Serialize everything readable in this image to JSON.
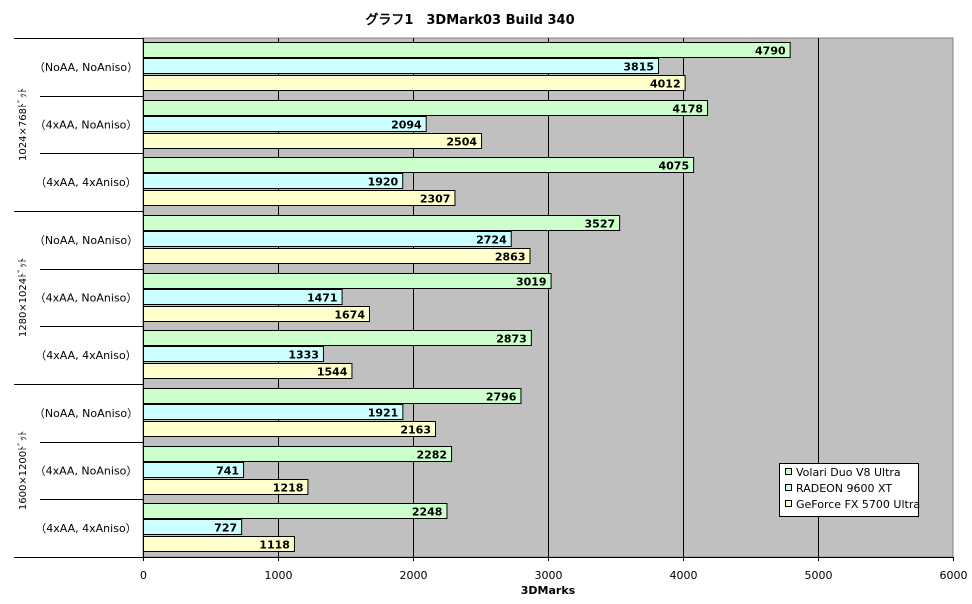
{
  "chart_data": {
    "type": "bar",
    "orientation": "horizontal",
    "title": "グラフ1　3DMark03  Build 340",
    "xlabel": "3DMarks",
    "xlim": [
      0,
      6000
    ],
    "x_ticks": [
      "0",
      "1000",
      "2000",
      "3000",
      "4000",
      "5000",
      "6000"
    ],
    "grid": true,
    "legend_position": "bottom-right",
    "groups": [
      {
        "label": "1024×768ﾄﾞｯﾄ",
        "categories": [
          "（NoAA, NoAniso）",
          "（4xAA, NoAniso）",
          "（4xAA, 4xAniso）"
        ]
      },
      {
        "label": "1280×1024ﾄﾞｯﾄ",
        "categories": [
          "（NoAA, NoAniso）",
          "（4xAA, NoAniso）",
          "（4xAA, 4xAniso）"
        ]
      },
      {
        "label": "1600×1200ﾄﾞｯﾄ",
        "categories": [
          "（NoAA, NoAniso）",
          "（4xAA, NoAniso）",
          "（4xAA, 4xAniso）"
        ]
      }
    ],
    "series": [
      {
        "name": "Volari Duo V8 Ultra",
        "color": "#ccffcc",
        "values": [
          4790,
          4178,
          4075,
          3527,
          3019,
          2873,
          2796,
          2282,
          2248
        ]
      },
      {
        "name": "RADEON 9600 XT",
        "color": "#ccffff",
        "values": [
          3815,
          2094,
          1920,
          2724,
          1471,
          1333,
          1921,
          741,
          727
        ]
      },
      {
        "name": "GeForce FX 5700 Ultra",
        "color": "#ffffcc",
        "values": [
          4012,
          2504,
          2307,
          2863,
          1674,
          1544,
          2163,
          1218,
          1118
        ]
      }
    ],
    "plot_background": "#c0c0c0"
  }
}
